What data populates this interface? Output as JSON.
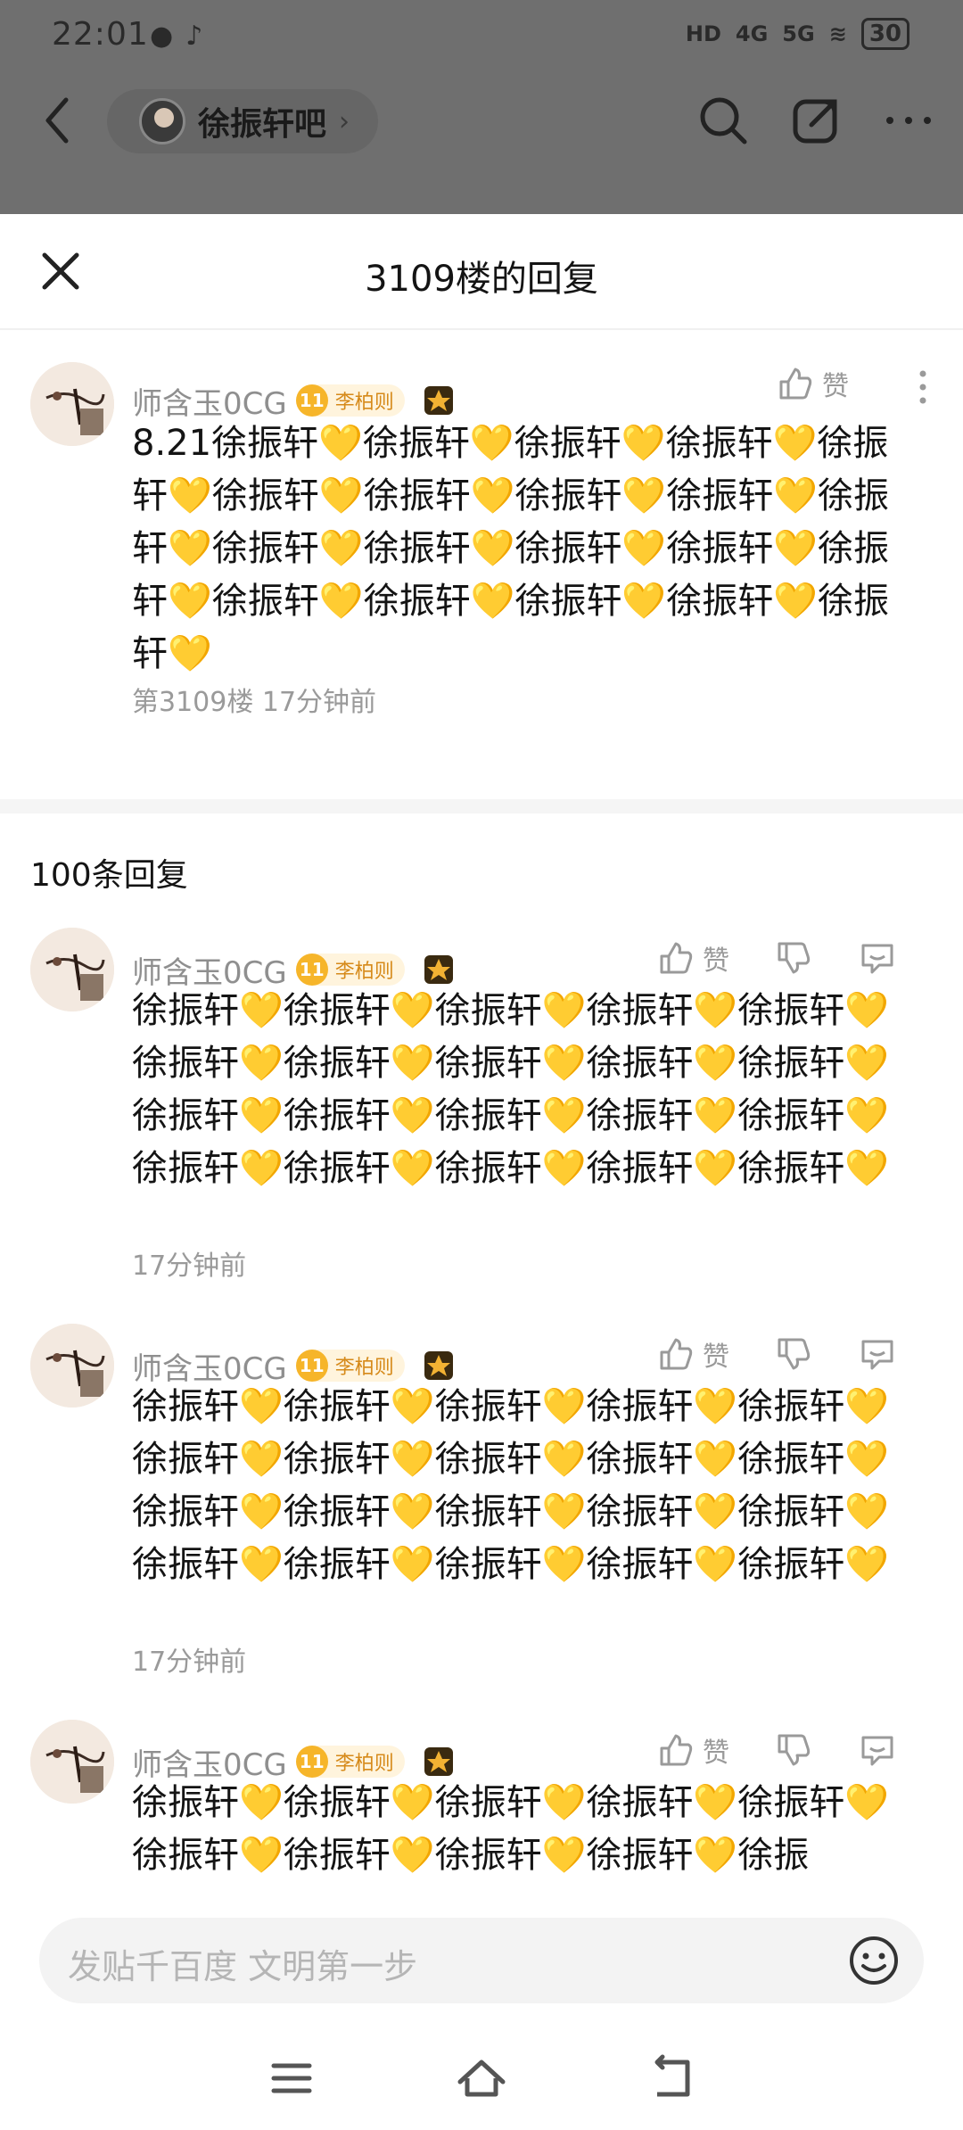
{
  "status": {
    "time": "22:01",
    "network_hd": "HD",
    "net4g": "4G",
    "net5g": "5G",
    "battery": "30"
  },
  "forum": {
    "name": "徐振轩吧"
  },
  "sheet": {
    "title": "3109楼的回复"
  },
  "main_post": {
    "author": "师含玉0CG",
    "level": "11",
    "level_name": "李柏则",
    "text": "8.21徐振轩💛徐振轩💛徐振轩💛徐振轩💛徐振轩💛徐振轩💛徐振轩💛徐振轩💛徐振轩💛徐振轩💛徐振轩💛徐振轩💛徐振轩💛徐振轩💛徐振轩💛徐振轩💛徐振轩💛徐振轩💛徐振轩💛徐振轩💛",
    "meta": "第3109楼 17分钟前",
    "like_label": "赞"
  },
  "replies_header": "100条回复",
  "replies": [
    {
      "author": "师含玉0CG",
      "level": "11",
      "level_name": "李柏则",
      "text": "徐振轩💛徐振轩💛徐振轩💛徐振轩💛徐振轩💛徐振轩💛徐振轩💛徐振轩💛徐振轩💛徐振轩💛徐振轩💛徐振轩💛徐振轩💛徐振轩💛徐振轩💛徐振轩💛徐振轩💛徐振轩💛徐振轩💛徐振轩💛",
      "meta": "17分钟前",
      "like_label": "赞"
    },
    {
      "author": "师含玉0CG",
      "level": "11",
      "level_name": "李柏则",
      "text": "徐振轩💛徐振轩💛徐振轩💛徐振轩💛徐振轩💛徐振轩💛徐振轩💛徐振轩💛徐振轩💛徐振轩💛徐振轩💛徐振轩💛徐振轩💛徐振轩💛徐振轩💛徐振轩💛徐振轩💛徐振轩💛徐振轩💛徐振轩💛",
      "meta": "17分钟前",
      "like_label": "赞"
    },
    {
      "author": "师含玉0CG",
      "level": "11",
      "level_name": "李柏则",
      "text": "徐振轩💛徐振轩💛徐振轩💛徐振轩💛徐振轩💛徐振轩💛徐振轩💛徐振轩💛徐振轩💛徐振",
      "meta": "",
      "like_label": "赞"
    }
  ],
  "input": {
    "placeholder": "发贴千百度 文明第一步"
  },
  "colors": {
    "accent_gold": "#f6b52a",
    "meta_gray": "#9a9a9a",
    "dim_overlay": "#6f6f6f"
  },
  "icons": [
    "back-icon",
    "search-icon",
    "share-icon",
    "more-icon",
    "close-icon",
    "thumb-up-icon",
    "thumb-down-icon",
    "comment-icon",
    "emoji-icon",
    "menu-icon",
    "home-icon",
    "return-icon"
  ]
}
